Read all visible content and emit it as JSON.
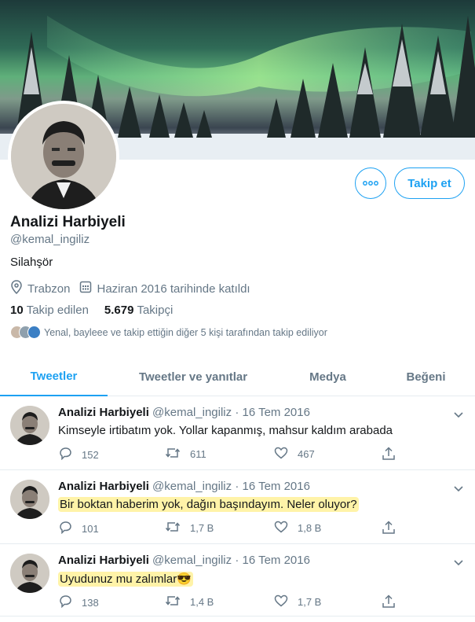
{
  "profile": {
    "name": "Analizi Harbiyeli",
    "handle": "@kemal_ingiliz",
    "bio": "Silahşör",
    "location": "Trabzon",
    "joined": "Haziran 2016 tarihinde katıldı",
    "following_count": "10",
    "following_label": "Takip edilen",
    "followers_count": "5.679",
    "followers_label": "Takipçi",
    "mutuals_text": "Yenal, bayleee ve takip ettiğin diğer 5 kişi tarafından takip ediliyor"
  },
  "buttons": {
    "more_icon": "more-icon",
    "follow_label": "Takip et"
  },
  "tabs": [
    {
      "label": "Tweetler",
      "active": true
    },
    {
      "label": "Tweetler ve yanıtlar",
      "active": false
    },
    {
      "label": "Medya",
      "active": false
    },
    {
      "label": "Beğeni",
      "active": false
    }
  ],
  "tweets": [
    {
      "name": "Analizi Harbiyeli",
      "handle": "@kemal_ingiliz",
      "date": "· 16 Tem 2016",
      "text": "Kimseyle irtibatım yok. Yollar kapanmış, mahsur kaldım arabada",
      "replies": "152",
      "retweets": "611",
      "likes": "467",
      "highlighted": false
    },
    {
      "name": "Analizi Harbiyeli",
      "handle": "@kemal_ingiliz",
      "date": "· 16 Tem 2016",
      "text": "Bir boktan haberim yok, dağın başındayım. Neler oluyor?",
      "replies": "101",
      "retweets": "1,7 B",
      "likes": "1,8 B",
      "highlighted": true
    },
    {
      "name": "Analizi Harbiyeli",
      "handle": "@kemal_ingiliz",
      "date": "· 16 Tem 2016",
      "text": "Uyudunuz mu zalımlar😎",
      "replies": "138",
      "retweets": "1,4 B",
      "likes": "1,7 B",
      "highlighted": true
    }
  ],
  "colors": {
    "accent": "#1da1f2",
    "muted": "#657786",
    "text": "#14171a",
    "highlight": "#fff3a8"
  },
  "icons": [
    "location-icon",
    "calendar-icon",
    "chevron-down-icon",
    "reply-icon",
    "retweet-icon",
    "like-icon",
    "share-icon",
    "more-icon"
  ]
}
